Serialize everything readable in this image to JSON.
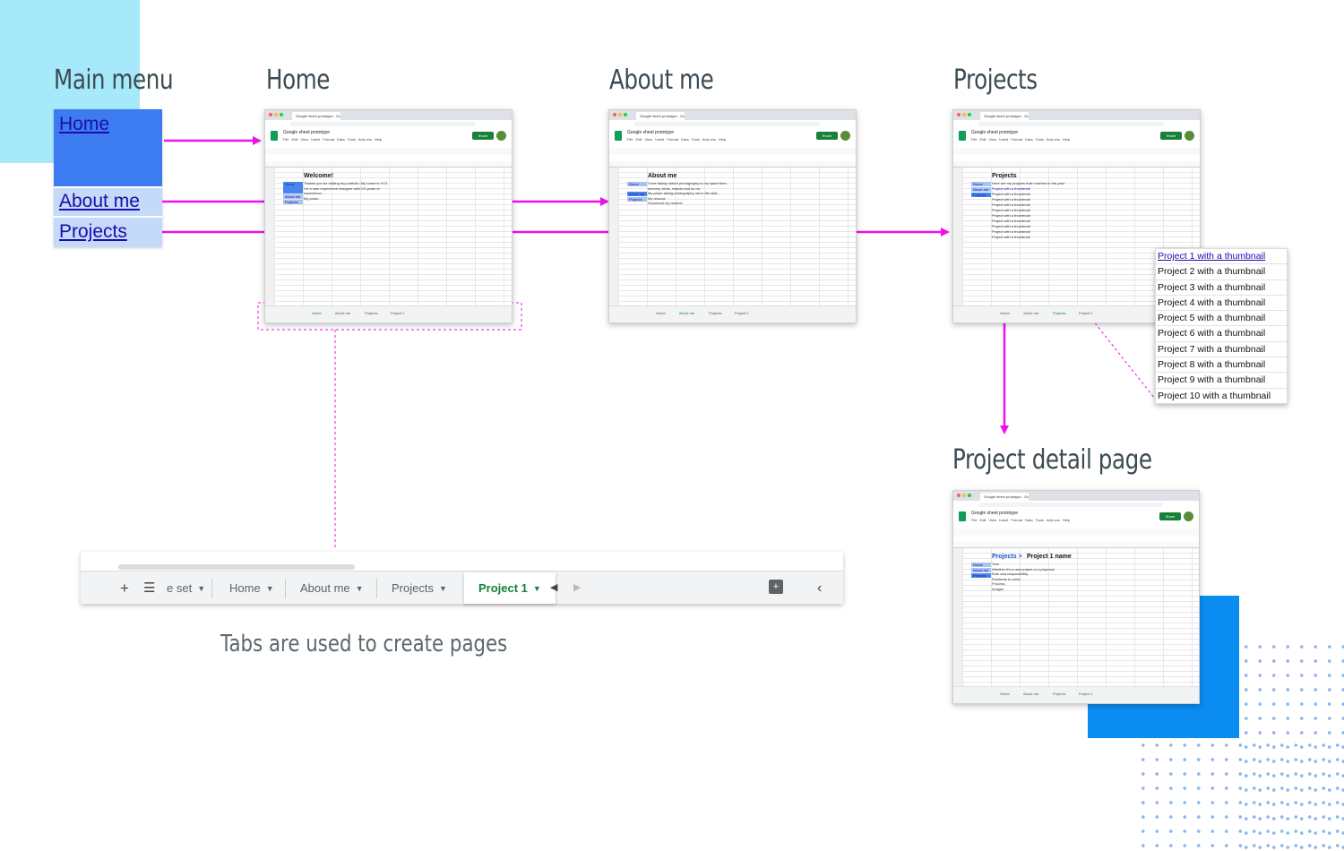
{
  "headings": {
    "main_menu": "Main menu",
    "home": "Home",
    "about": "About me",
    "projects": "Projects",
    "detail": "Project detail page"
  },
  "main_menu": {
    "items": [
      "Home",
      "About me",
      "Projects"
    ]
  },
  "caption": "Tabs are used to create pages",
  "big_tabs": {
    "partial": "e set",
    "home": "Home",
    "about": "About me",
    "projects": "Projects",
    "active": "Project 1"
  },
  "thumb_common": {
    "tab_title": "Google sheet prototype - Go...",
    "doc_title": "Google sheet prototype",
    "menus": "File  Edit  View  Insert  Format  Data  Tools  Add-ons  Help",
    "share": "Share",
    "tabs": [
      "Home",
      "About me",
      "Projects",
      "Project 1"
    ]
  },
  "thumb_home": {
    "title": "Welcome!",
    "lines": [
      "Thanks you for visiting my portfolio. My name is XYZ.",
      "I'm a user experience designer with XX years of",
      "experience.",
      "My photo"
    ],
    "menu": [
      "Home",
      "About me",
      "Projects"
    ]
  },
  "thumb_about": {
    "title": "About me",
    "lines": [
      "I love taking nature photography in my spare time,",
      "scenery, birds, insects and so on.",
      "My photo taking photography out in the wild...",
      "My resume",
      "Download my resume"
    ],
    "menu": [
      "Home",
      "About me",
      "Projects"
    ]
  },
  "thumb_projects": {
    "title": "Projects",
    "lines": [
      "Here are my projects that I worked in the past",
      "Project with a thumbnail"
    ],
    "menu": [
      "Home",
      "About me",
      "Projects"
    ]
  },
  "thumb_detail": {
    "crumb": "Projects >",
    "title": "Project 1 name",
    "lines": [
      "Year",
      "Whether it's a real project or a proposal",
      "Role and responsibility",
      "Problems to solve",
      "Process",
      "Images"
    ],
    "menu": [
      "Home",
      "About me",
      "Projects"
    ]
  },
  "project_list": [
    "Project 1 with a thumbnail",
    "Project 2 with a thumbnail",
    "Project 3 with a thumbnail",
    "Project 4 with a thumbnail",
    "Project 5 with a thumbnail",
    "Project 6 with a thumbnail",
    "Project 7 with a thumbnail",
    "Project 8 with a thumbnail",
    "Project 9 with a thumbnail",
    "Project 10 with a thumbnail"
  ],
  "colors": {
    "arrow": "#ee11ee",
    "light_blue": "#a6e9fb",
    "accent_blue": "#0a8cf0",
    "menu_blue": "#3d7bf0",
    "menu_light": "#c5d9f8",
    "sheets_green": "#188038"
  }
}
